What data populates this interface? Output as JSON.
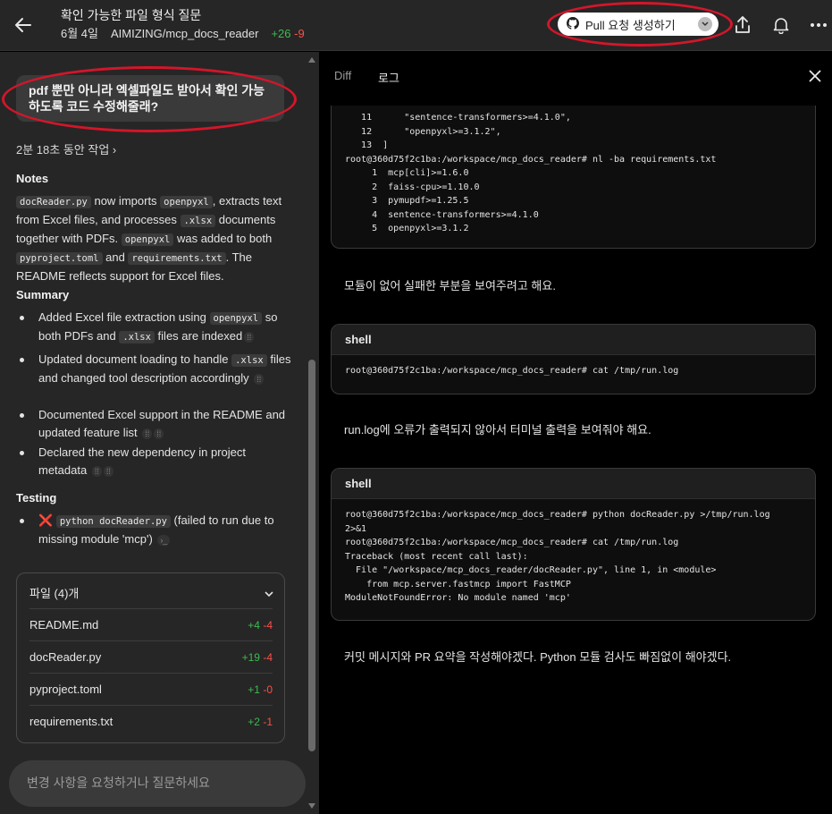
{
  "header": {
    "title": "확인 가능한 파일 형식 질문",
    "date": "6월 4일",
    "repo": "AIMIZING/mcp_docs_reader",
    "additions": "+26",
    "deletions": "-9",
    "pr_button_label": "Pull 요청 생성하기",
    "annotation_color": "#d3162a"
  },
  "left": {
    "user_message": "pdf 뿐만 아니라 엑셀파일도 받아서 확인 가능하도록 코드 수정해줄래?",
    "worked_label": "2분 18초 동안 작업",
    "notes_heading": "Notes",
    "notes": {
      "code1": "docReader.py",
      "t1": " now imports ",
      "code2": "openpyxl",
      "t2": ", extracts text from Excel files, and processes ",
      "code3": ".xlsx",
      "t3": " documents together with PDFs. ",
      "code4": "openpyxl",
      "t4": " was added to both ",
      "code5": "pyproject.toml",
      "t5": " and ",
      "code6": "requirements.txt",
      "t6": ". The README reflects support for Excel files."
    },
    "summary_heading": "Summary",
    "summary": [
      {
        "a": "Added Excel file extraction using ",
        "code1": "openpyxl",
        "b": " so both PDFs and ",
        "code2": ".xlsx",
        "c": " files are indexed"
      },
      {
        "a": "Updated document loading to handle ",
        "code1": ".xlsx",
        "b": " files and changed tool description accordingly"
      },
      {
        "a": "Documented Excel support in the README and updated feature list"
      },
      {
        "a": "Declared the new dependency in project metadata"
      }
    ],
    "testing_heading": "Testing",
    "testing": {
      "status_icon": "❌",
      "code": "python docReader.py",
      "text": " (failed to run due to missing module 'mcp')",
      "term_icon": "›_"
    },
    "files": {
      "heading": "파일 (4)개",
      "items": [
        {
          "name": "README.md",
          "add": "+4",
          "del": "-4"
        },
        {
          "name": "docReader.py",
          "add": "+19",
          "del": "-4"
        },
        {
          "name": "pyproject.toml",
          "add": "+1",
          "del": "-0"
        },
        {
          "name": "requirements.txt",
          "add": "+2",
          "del": "-1"
        }
      ]
    },
    "input_placeholder": "변경 사항을 요청하거나 질문하세요"
  },
  "right": {
    "tabs": [
      "Diff",
      "로그"
    ],
    "code_top": "   11      \"sentence-transformers>=4.1.0\",\n   12      \"openpyxl>=3.1.2\",\n   13  ]\nroot@360d75f2c1ba:/workspace/mcp_docs_reader# nl -ba requirements.txt\n     1  mcp[cli]>=1.6.0\n     2  faiss-cpu>=1.10.0\n     3  pymupdf>=1.25.5\n     4  sentence-transformers>=4.1.0\n     5  openpyxl>=3.1.2",
    "msg1": "모듈이 없어 실패한 부분을 보여주려고 해요.",
    "shell1": {
      "label": "shell",
      "body": "root@360d75f2c1ba:/workspace/mcp_docs_reader# cat /tmp/run.log"
    },
    "msg2": "run.log에 오류가 출력되지 않아서 터미널 출력을 보여줘야 해요.",
    "shell2": {
      "label": "shell",
      "body": "root@360d75f2c1ba:/workspace/mcp_docs_reader# python docReader.py >/tmp/run.log\n2>&1\nroot@360d75f2c1ba:/workspace/mcp_docs_reader# cat /tmp/run.log\nTraceback (most recent call last):\n  File \"/workspace/mcp_docs_reader/docReader.py\", line 1, in <module>\n    from mcp.server.fastmcp import FastMCP\nModuleNotFoundError: No module named 'mcp'"
    },
    "msg3": "커밋 메시지와 PR 요약을 작성해야겠다. Python 모듈 검사도 빠짐없이 해야겠다."
  }
}
